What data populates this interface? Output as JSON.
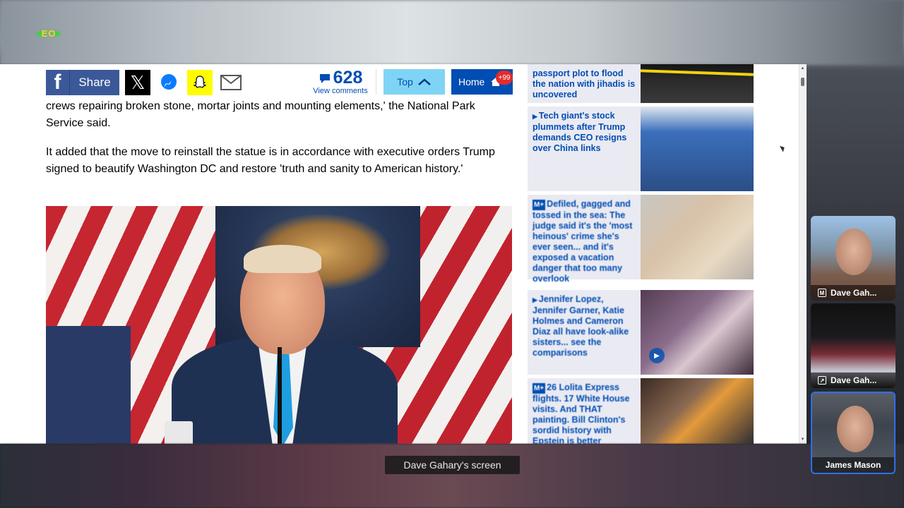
{
  "share_bar": {
    "share_label": "Share",
    "comment_count": "628",
    "view_comments": "View comments",
    "top_label": "Top",
    "home_label": "Home",
    "home_badge": "+99"
  },
  "article": {
    "paragraph_1": "crews repairing broken stone, mortar joints and mounting elements,' the National Park Service said.",
    "paragraph_2": "It added that the move to reinstall the statue is in accordance with executive orders Trump signed to beautify Washington DC and restore 'truth and sanity to American history.'"
  },
  "sidebar": {
    "items": [
      {
        "text": "passport plot to flood the nation with jihadis is uncovered"
      },
      {
        "text": "Tech giant's stock plummets after Trump demands CEO resigns over China links"
      },
      {
        "text": "Defiled, gagged and tossed in the sea: The judge said it's the 'most heinous' crime she's ever seen... and it's exposed a vacation danger that too many overlook"
      },
      {
        "text": "Jennifer Lopez, Jennifer Garner, Katie Holmes and Cameron Diaz all have look-alike sisters... see the comparisons"
      },
      {
        "text": "26 Lolita Express flights. 17 White House visits. And THAT painting. Bill Clinton's sordid history with Epstein is better"
      }
    ]
  },
  "caption": "Dave Gahary's screen",
  "participants": [
    {
      "name": "Dave Gah..."
    },
    {
      "name": "Dave Gah..."
    },
    {
      "name": "James Mason"
    }
  ],
  "colors": {
    "brand_blue": "#004db3",
    "facebook": "#3b5998",
    "top_button": "#7fd4f5",
    "active_speaker": "#2f6fea"
  }
}
